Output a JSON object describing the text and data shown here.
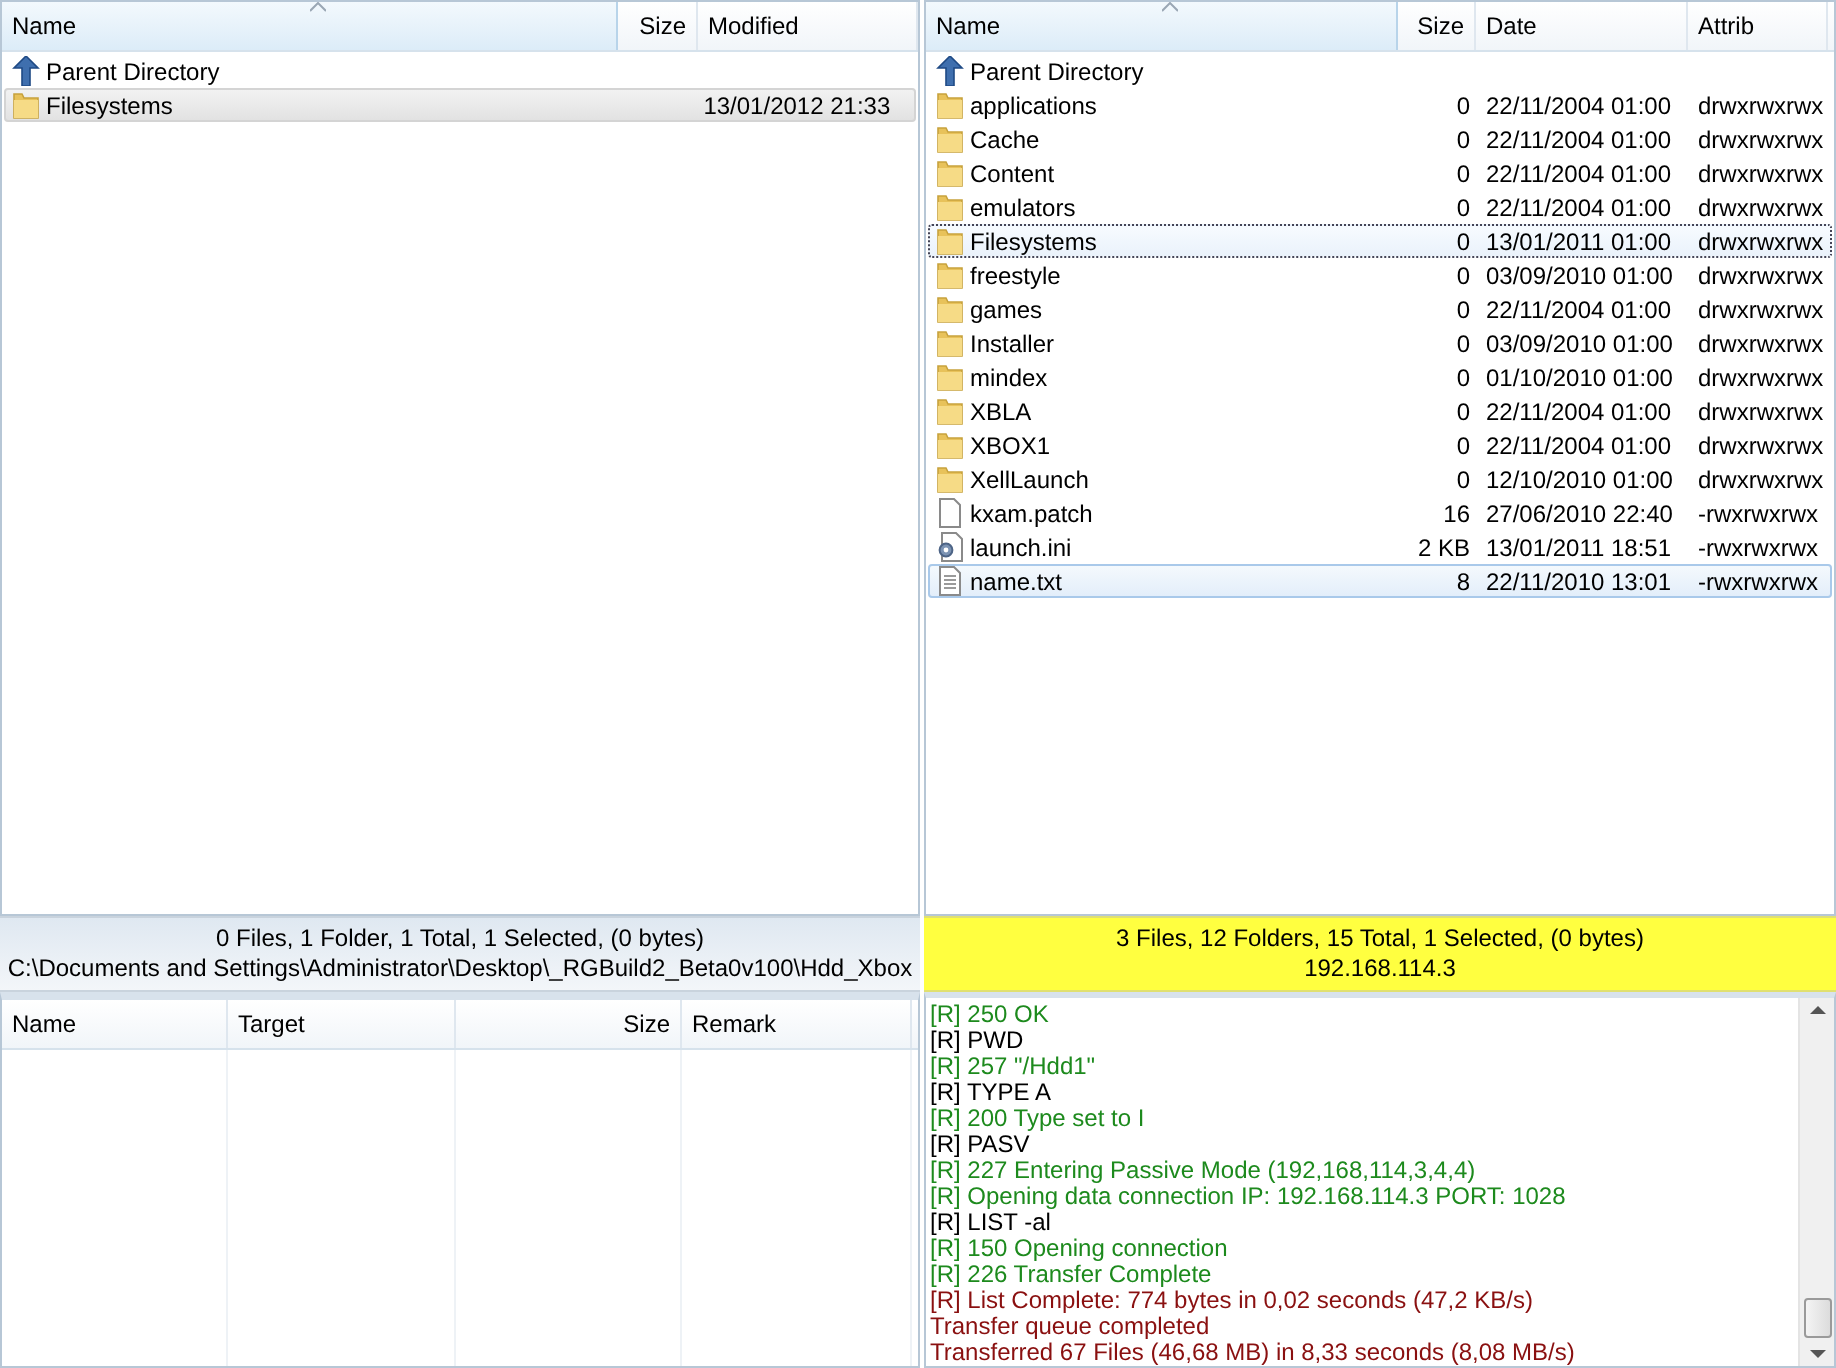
{
  "local_pane": {
    "columns": [
      {
        "label": "Name",
        "sorted": true
      },
      {
        "label": "Size",
        "sorted": false
      },
      {
        "label": "Modified",
        "sorted": false
      }
    ],
    "rows": [
      {
        "kind": "parent",
        "cells": [
          "Parent Directory",
          "",
          ""
        ],
        "selected": false,
        "focused": false
      },
      {
        "kind": "folder",
        "cells": [
          "Filesystems",
          "",
          "13/01/2012 21:33"
        ],
        "selected": true,
        "focused": false
      }
    ]
  },
  "remote_pane": {
    "columns": [
      {
        "label": "Name",
        "sorted": true
      },
      {
        "label": "Size",
        "sorted": false
      },
      {
        "label": "Date",
        "sorted": false
      },
      {
        "label": "Attrib",
        "sorted": false
      }
    ],
    "rows": [
      {
        "kind": "parent",
        "cells": [
          "Parent Directory",
          "",
          "",
          ""
        ],
        "selected": false,
        "focused": false
      },
      {
        "kind": "folder",
        "cells": [
          "applications",
          "0",
          "22/11/2004 01:00",
          "drwxrwxrwx"
        ],
        "selected": false,
        "focused": false
      },
      {
        "kind": "folder",
        "cells": [
          "Cache",
          "0",
          "22/11/2004 01:00",
          "drwxrwxrwx"
        ],
        "selected": false,
        "focused": false
      },
      {
        "kind": "folder",
        "cells": [
          "Content",
          "0",
          "22/11/2004 01:00",
          "drwxrwxrwx"
        ],
        "selected": false,
        "focused": false
      },
      {
        "kind": "folder",
        "cells": [
          "emulators",
          "0",
          "22/11/2004 01:00",
          "drwxrwxrwx"
        ],
        "selected": false,
        "focused": false
      },
      {
        "kind": "folder",
        "cells": [
          "Filesystems",
          "0",
          "13/01/2011 01:00",
          "drwxrwxrwx"
        ],
        "selected": false,
        "focused": true
      },
      {
        "kind": "folder",
        "cells": [
          "freestyle",
          "0",
          "03/09/2010 01:00",
          "drwxrwxrwx"
        ],
        "selected": false,
        "focused": false
      },
      {
        "kind": "folder",
        "cells": [
          "games",
          "0",
          "22/11/2004 01:00",
          "drwxrwxrwx"
        ],
        "selected": false,
        "focused": false
      },
      {
        "kind": "folder",
        "cells": [
          "Installer",
          "0",
          "03/09/2010 01:00",
          "drwxrwxrwx"
        ],
        "selected": false,
        "focused": false
      },
      {
        "kind": "folder",
        "cells": [
          "mindex",
          "0",
          "01/10/2010 01:00",
          "drwxrwxrwx"
        ],
        "selected": false,
        "focused": false
      },
      {
        "kind": "folder",
        "cells": [
          "XBLA",
          "0",
          "22/11/2004 01:00",
          "drwxrwxrwx"
        ],
        "selected": false,
        "focused": false
      },
      {
        "kind": "folder",
        "cells": [
          "XBOX1",
          "0",
          "22/11/2004 01:00",
          "drwxrwxrwx"
        ],
        "selected": false,
        "focused": false
      },
      {
        "kind": "folder",
        "cells": [
          "XellLaunch",
          "0",
          "12/10/2010 01:00",
          "drwxrwxrwx"
        ],
        "selected": false,
        "focused": false
      },
      {
        "kind": "file",
        "cells": [
          "kxam.patch",
          "16",
          "27/06/2010 22:40",
          "-rwxrwxrwx"
        ],
        "selected": false,
        "focused": false
      },
      {
        "kind": "config",
        "cells": [
          "launch.ini",
          "2 KB",
          "13/01/2011 18:51",
          "-rwxrwxrwx"
        ],
        "selected": false,
        "focused": false
      },
      {
        "kind": "text",
        "cells": [
          "name.txt",
          "8",
          "22/11/2010 13:01",
          "-rwxrwxrwx"
        ],
        "selected": true,
        "focused": false
      }
    ]
  },
  "local_status": {
    "active": false,
    "summary": "0 Files, 1 Folder, 1 Total, 1 Selected, (0 bytes)",
    "location": "C:\\Documents and Settings\\Administrator\\Desktop\\_RGBuild2_Beta0v100\\Hdd_Xbox"
  },
  "remote_status": {
    "active": true,
    "summary": "3 Files, 12 Folders, 15 Total, 1 Selected, (0 bytes)",
    "location": "192.168.114.3"
  },
  "queue": {
    "columns": [
      {
        "label": "Name"
      },
      {
        "label": "Target"
      },
      {
        "label": "Size"
      },
      {
        "label": "Remark"
      }
    ]
  },
  "log": [
    {
      "kind": "response",
      "text": "[R] 250 OK"
    },
    {
      "kind": "command",
      "text": "[R] PWD"
    },
    {
      "kind": "response",
      "text": "[R] 257 \"/Hdd1\""
    },
    {
      "kind": "command",
      "text": "[R] TYPE A"
    },
    {
      "kind": "response",
      "text": "[R] 200 Type set to I"
    },
    {
      "kind": "command",
      "text": "[R] PASV"
    },
    {
      "kind": "response",
      "text": "[R] 227 Entering Passive Mode (192,168,114,3,4,4)"
    },
    {
      "kind": "response",
      "text": "[R] Opening data connection IP: 192.168.114.3 PORT: 1028"
    },
    {
      "kind": "command",
      "text": "[R] LIST -al"
    },
    {
      "kind": "response",
      "text": "[R] 150 Opening connection"
    },
    {
      "kind": "response",
      "text": "[R] 226 Transfer Complete"
    },
    {
      "kind": "status",
      "text": "[R] List Complete: 774 bytes in 0,02 seconds (47,2 KB/s)"
    },
    {
      "kind": "status",
      "text": "Transfer queue completed"
    },
    {
      "kind": "status",
      "text": "Transferred 67 Files (46,68 MB) in 8,33 seconds (8,08 MB/s)"
    }
  ]
}
